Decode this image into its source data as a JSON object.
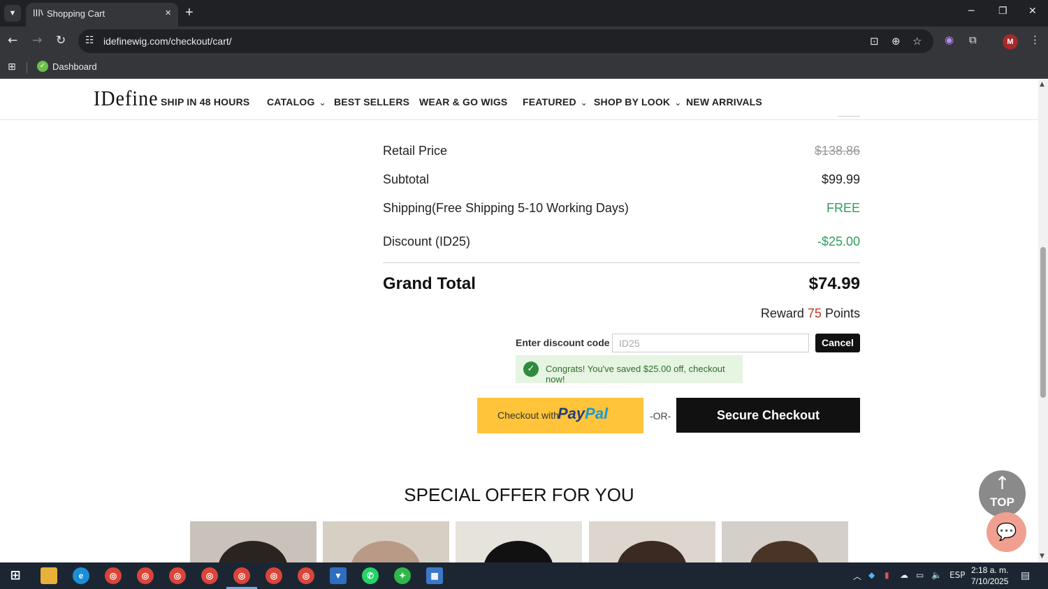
{
  "browser": {
    "tab_title": "Shopping Cart",
    "url": "idefinewig.com/checkout/cart/",
    "bookmark": "Dashboard",
    "profile_initial": "M",
    "accent": "#35363a"
  },
  "site": {
    "logo": "IDefine",
    "nav": [
      {
        "label": "SHIP IN 48 HOURS",
        "dropdown": false
      },
      {
        "label": "CATALOG",
        "dropdown": true
      },
      {
        "label": "BEST SELLERS",
        "dropdown": false
      },
      {
        "label": "WEAR & GO WIGS",
        "dropdown": false
      },
      {
        "label": "FEATURED",
        "dropdown": true
      },
      {
        "label": "SHOP BY LOOK",
        "dropdown": true
      },
      {
        "label": "NEW ARRIVALS",
        "dropdown": false
      }
    ]
  },
  "summary": {
    "retail_label": "Retail Price",
    "retail_value": "$138.86",
    "subtotal_label": "Subtotal",
    "subtotal_value": "$99.99",
    "shipping_label": "Shipping(Free Shipping 5-10 Working Days)",
    "shipping_value": "FREE",
    "discount_label": "Discount (ID25)",
    "discount_value": "-$25.00",
    "grand_label": "Grand Total",
    "grand_value": "$74.99",
    "reward_prefix": "Reward",
    "reward_points": "75",
    "reward_suffix": "Points"
  },
  "discount": {
    "label": "Enter discount code",
    "value": "ID25",
    "cancel": "Cancel",
    "message": "Congrats! You've saved $25.00 off, checkout now!"
  },
  "checkout": {
    "paypal_prefix": "Checkout with",
    "paypal_brand_1": "Pay",
    "paypal_brand_2": "Pal",
    "or": "-OR-",
    "secure": "Secure Checkout"
  },
  "offer": {
    "title": "SPECIAL OFFER FOR YOU",
    "products": [
      {
        "bg": "#c9c2ba",
        "hair": "#2a2420"
      },
      {
        "bg": "#d8cfc4",
        "hair": "#b89a86"
      },
      {
        "bg": "#e6e2dc",
        "hair": "#111111"
      },
      {
        "bg": "#ddd6cf",
        "hair": "#3a2a22"
      },
      {
        "bg": "#d4cfc9",
        "hair": "#4a3426"
      }
    ]
  },
  "floating": {
    "top_label": "TOP"
  },
  "taskbar": {
    "lang": "ESP",
    "time": "2:18 a. m.",
    "date": "7/10/2025"
  }
}
